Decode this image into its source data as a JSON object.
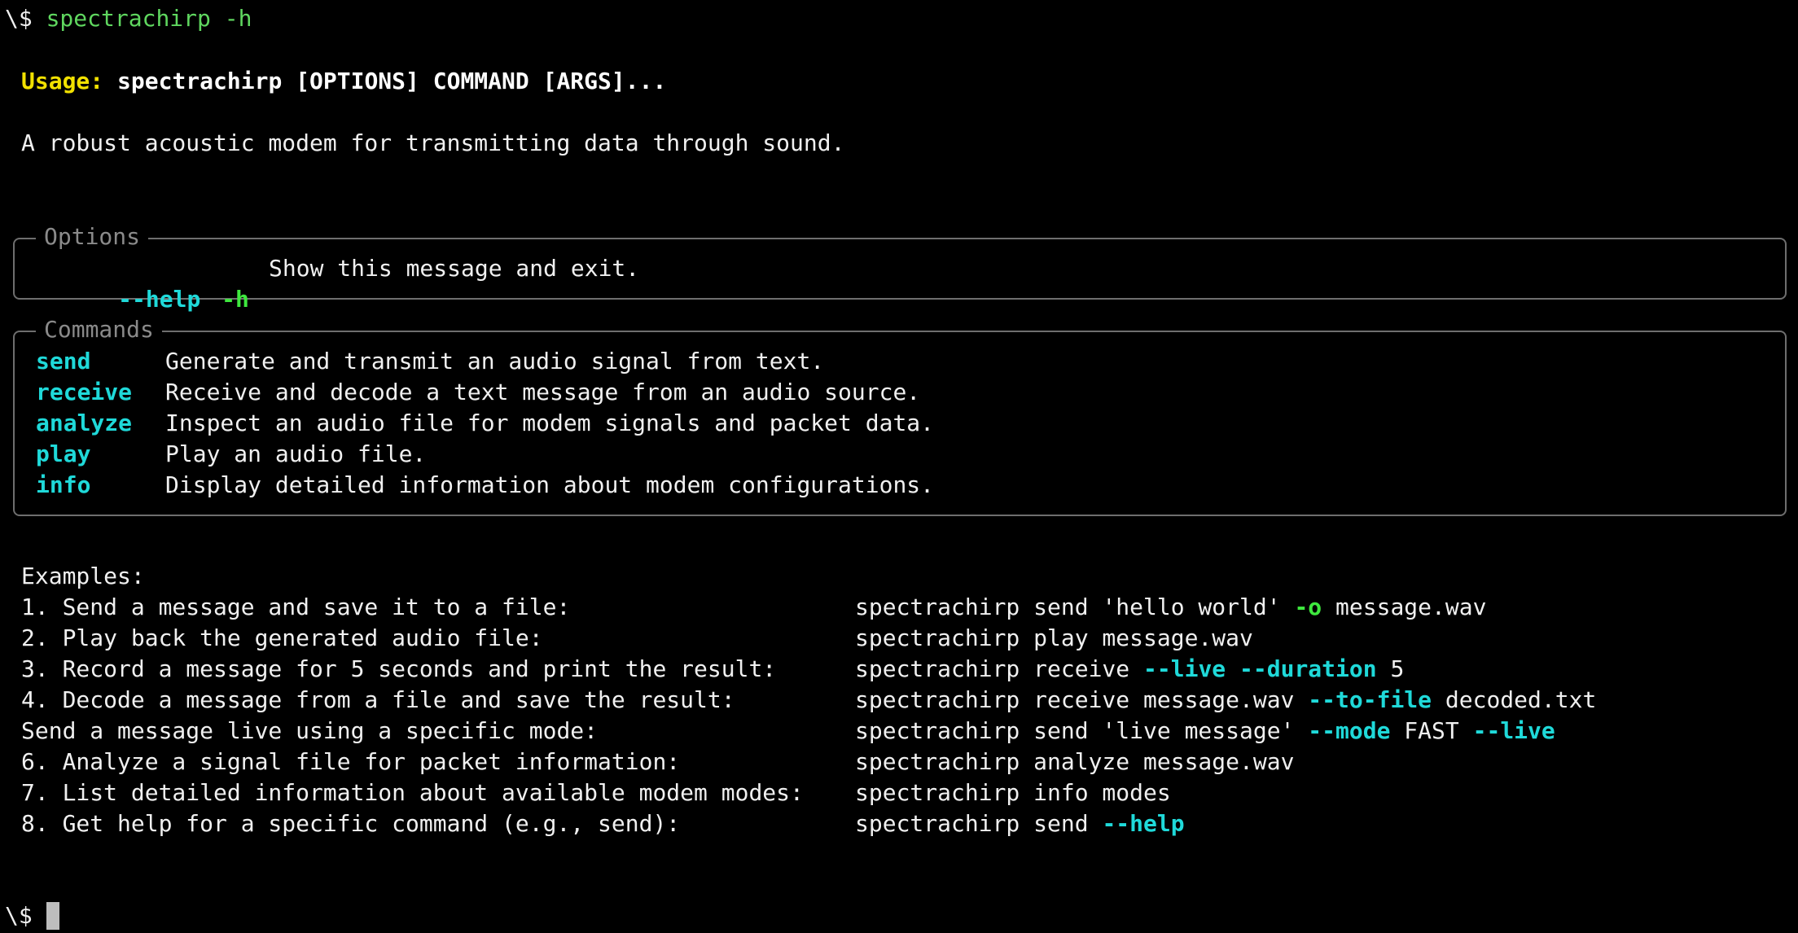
{
  "prompt": {
    "symbol": "\\$",
    "command": "spectrachirp -h"
  },
  "usage": {
    "label": "Usage:",
    "text": "spectrachirp [OPTIONS] COMMAND [ARGS]..."
  },
  "description": "A robust acoustic modem for transmitting data through sound.",
  "options_panel": {
    "title": "Options",
    "items": [
      {
        "long": "--help",
        "short": "-h",
        "desc": "Show this message and exit."
      }
    ]
  },
  "commands_panel": {
    "title": "Commands",
    "items": [
      {
        "name": "send",
        "desc": "Generate and transmit an audio signal from text."
      },
      {
        "name": "receive",
        "desc": "Receive and decode a text message from an audio source."
      },
      {
        "name": "analyze",
        "desc": "Inspect an audio file for modem signals and packet data."
      },
      {
        "name": "play",
        "desc": "Play an audio file."
      },
      {
        "name": "info",
        "desc": "Display detailed information about modem configurations."
      }
    ]
  },
  "examples": {
    "heading": "Examples:",
    "items": [
      {
        "desc": "1. Send a message and save it to a file:",
        "cmd_a": "spectrachirp send 'hello world' ",
        "flag_a": "-o",
        "cmd_b": " message.wav",
        "flag_b": "",
        "cmd_c": "",
        "flag_c": ""
      },
      {
        "desc": "2. Play back the generated audio file:",
        "cmd_a": "spectrachirp play message.wav",
        "flag_a": "",
        "cmd_b": "",
        "flag_b": "",
        "cmd_c": "",
        "flag_c": ""
      },
      {
        "desc": "3. Record a message for 5 seconds and print the result:",
        "cmd_a": "spectrachirp receive ",
        "flag_a": "--live --duration",
        "cmd_b": " 5",
        "flag_b": "",
        "cmd_c": "",
        "flag_c": ""
      },
      {
        "desc": "4. Decode a message from a file and save the result:",
        "cmd_a": "spectrachirp receive message.wav ",
        "flag_a": "--to-file",
        "cmd_b": " decoded.txt",
        "flag_b": "",
        "cmd_c": "",
        "flag_c": ""
      },
      {
        "desc": "Send a message live using a specific mode:",
        "cmd_a": "spectrachirp send 'live message' ",
        "flag_a": "--mode",
        "cmd_b": " FAST ",
        "flag_b": "--live",
        "cmd_c": "",
        "flag_c": ""
      },
      {
        "desc": "6. Analyze a signal file for packet information:",
        "cmd_a": "spectrachirp analyze message.wav",
        "flag_a": "",
        "cmd_b": "",
        "flag_b": "",
        "cmd_c": "",
        "flag_c": ""
      },
      {
        "desc": "7. List detailed information about available modem modes:",
        "cmd_a": "spectrachirp info modes",
        "flag_a": "",
        "cmd_b": "",
        "flag_b": "",
        "cmd_c": "",
        "flag_c": ""
      },
      {
        "desc": "8. Get help for a specific command (e.g., send):",
        "cmd_a": "spectrachirp send ",
        "flag_a": "--help",
        "cmd_b": "",
        "flag_b": "",
        "cmd_c": "",
        "flag_c": ""
      }
    ]
  },
  "final_prompt": {
    "symbol": "\\$"
  },
  "colors": {
    "background": "#000000",
    "prompt_command": "#5fd75f",
    "usage_label": "#f2e100",
    "flag_cyan": "#1fd9d9",
    "short_flag_green": "#3ee83e",
    "panel_border": "#6e6e6e"
  }
}
